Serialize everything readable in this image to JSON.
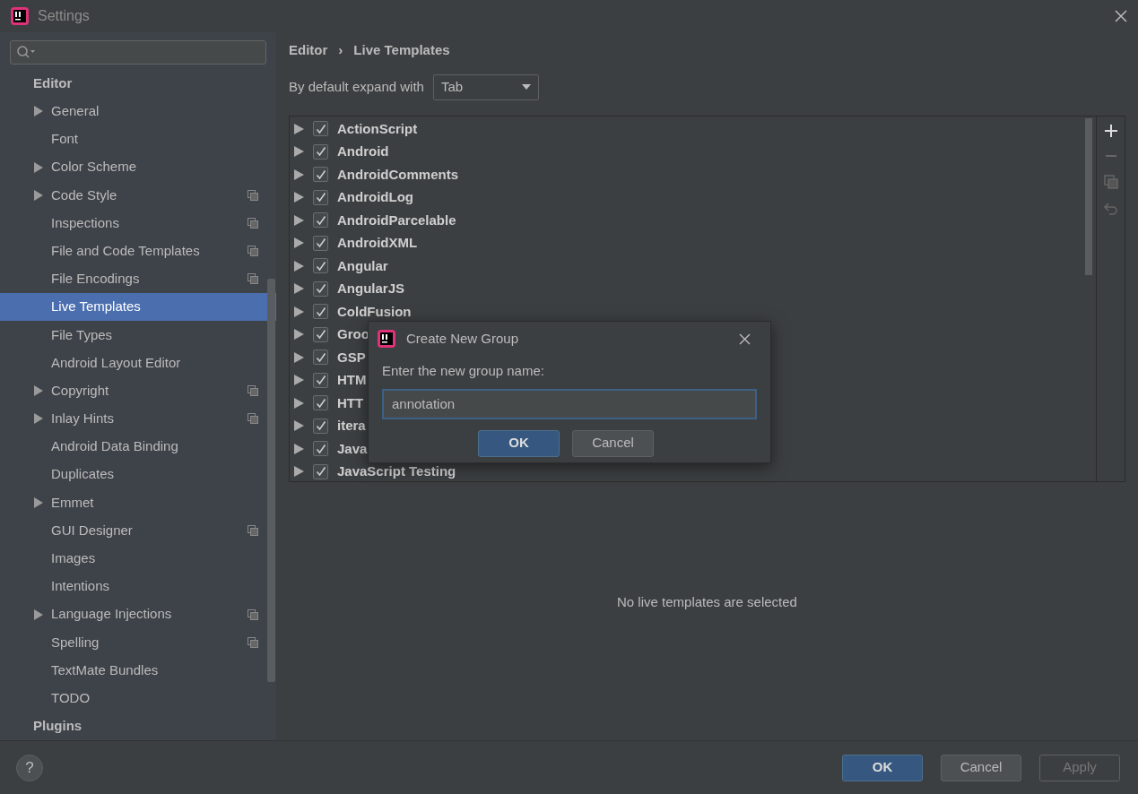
{
  "window": {
    "title": "Settings"
  },
  "sidebar": {
    "items": [
      {
        "label": "Editor",
        "kind": "header",
        "selected": false
      },
      {
        "label": "General",
        "kind": "item",
        "expandable": true,
        "shared": false,
        "selected": false
      },
      {
        "label": "Font",
        "kind": "item",
        "expandable": false,
        "shared": false,
        "selected": false
      },
      {
        "label": "Color Scheme",
        "kind": "item",
        "expandable": true,
        "shared": false,
        "selected": false
      },
      {
        "label": "Code Style",
        "kind": "item",
        "expandable": true,
        "shared": true,
        "selected": false
      },
      {
        "label": "Inspections",
        "kind": "item",
        "expandable": false,
        "shared": true,
        "selected": false
      },
      {
        "label": "File and Code Templates",
        "kind": "item",
        "expandable": false,
        "shared": true,
        "selected": false
      },
      {
        "label": "File Encodings",
        "kind": "item",
        "expandable": false,
        "shared": true,
        "selected": false
      },
      {
        "label": "Live Templates",
        "kind": "item",
        "expandable": false,
        "shared": false,
        "selected": true
      },
      {
        "label": "File Types",
        "kind": "item",
        "expandable": false,
        "shared": false,
        "selected": false
      },
      {
        "label": "Android Layout Editor",
        "kind": "item",
        "expandable": false,
        "shared": false,
        "selected": false
      },
      {
        "label": "Copyright",
        "kind": "item",
        "expandable": true,
        "shared": true,
        "selected": false
      },
      {
        "label": "Inlay Hints",
        "kind": "item",
        "expandable": true,
        "shared": true,
        "selected": false
      },
      {
        "label": "Android Data Binding",
        "kind": "item",
        "expandable": false,
        "shared": false,
        "selected": false
      },
      {
        "label": "Duplicates",
        "kind": "item",
        "expandable": false,
        "shared": false,
        "selected": false
      },
      {
        "label": "Emmet",
        "kind": "item",
        "expandable": true,
        "shared": false,
        "selected": false
      },
      {
        "label": "GUI Designer",
        "kind": "item",
        "expandable": false,
        "shared": true,
        "selected": false
      },
      {
        "label": "Images",
        "kind": "item",
        "expandable": false,
        "shared": false,
        "selected": false
      },
      {
        "label": "Intentions",
        "kind": "item",
        "expandable": false,
        "shared": false,
        "selected": false
      },
      {
        "label": "Language Injections",
        "kind": "item",
        "expandable": true,
        "shared": true,
        "selected": false
      },
      {
        "label": "Spelling",
        "kind": "item",
        "expandable": false,
        "shared": true,
        "selected": false
      },
      {
        "label": "TextMate Bundles",
        "kind": "item",
        "expandable": false,
        "shared": false,
        "selected": false
      },
      {
        "label": "TODO",
        "kind": "item",
        "expandable": false,
        "shared": false,
        "selected": false
      },
      {
        "label": "Plugins",
        "kind": "header",
        "selected": false
      }
    ]
  },
  "breadcrumb": [
    "Editor",
    "›",
    "Live Templates"
  ],
  "expand_with": {
    "label": "By default expand with",
    "value": "Tab"
  },
  "template_groups": [
    {
      "label": "ActionScript",
      "checked": true
    },
    {
      "label": "Android",
      "checked": true
    },
    {
      "label": "AndroidComments",
      "checked": true
    },
    {
      "label": "AndroidLog",
      "checked": true
    },
    {
      "label": "AndroidParcelable",
      "checked": true
    },
    {
      "label": "AndroidXML",
      "checked": true
    },
    {
      "label": "Angular",
      "checked": true
    },
    {
      "label": "AngularJS",
      "checked": true
    },
    {
      "label": "ColdFusion",
      "checked": true
    },
    {
      "label": "Groo",
      "checked": true
    },
    {
      "label": "GSP",
      "checked": true
    },
    {
      "label": "HTM",
      "checked": true
    },
    {
      "label": "HTT",
      "checked": true
    },
    {
      "label": "itera",
      "checked": true
    },
    {
      "label": "Java",
      "checked": true
    },
    {
      "label": "JavaScript Testing",
      "checked": true
    }
  ],
  "empty_message": "No live templates are selected",
  "dialog": {
    "title": "Create New Group",
    "prompt": "Enter the new group name:",
    "value": "annotation",
    "buttons": [
      {
        "label": "OK",
        "default": true
      },
      {
        "label": "Cancel",
        "default": false
      }
    ]
  },
  "footer": {
    "help": "?",
    "buttons": [
      {
        "label": "OK",
        "kind": "default"
      },
      {
        "label": "Cancel",
        "kind": "normal"
      },
      {
        "label": "Apply",
        "kind": "disabled"
      }
    ]
  }
}
